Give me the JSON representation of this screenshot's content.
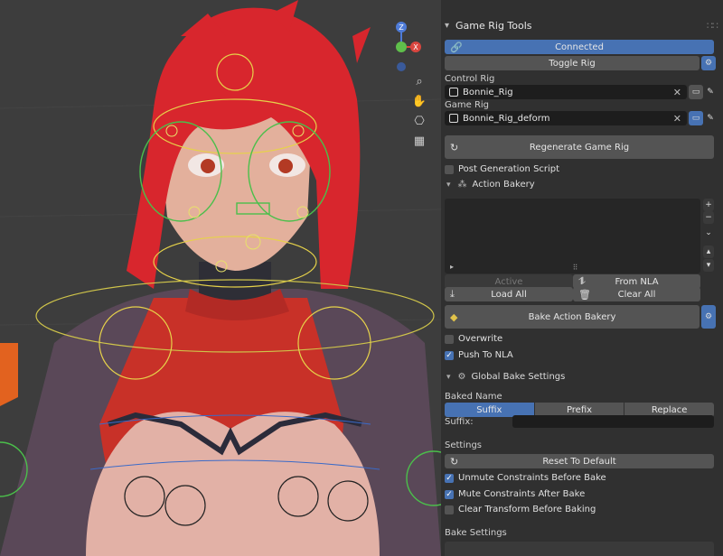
{
  "panel": {
    "title": "Game Rig Tools",
    "connected_label": "Connected",
    "toggle_rig_label": "Toggle Rig",
    "control_rig_label": "Control Rig",
    "control_rig_value": "Bonnie_Rig",
    "game_rig_label": "Game Rig",
    "game_rig_value": "Bonnie_Rig_deform",
    "regenerate_label": "Regenerate Game Rig",
    "post_generation_label": "Post Generation Script",
    "action_bakery_label": "Action Bakery",
    "active_label": "Active",
    "from_nla_label": "From NLA",
    "load_all_label": "Load All",
    "clear_all_label": "Clear All",
    "bake_action_bakery_label": "Bake Action Bakery",
    "overwrite_label": "Overwrite",
    "push_to_nla_label": "Push To NLA",
    "global_bake_label": "Global Bake Settings",
    "baked_name_label": "Baked Name",
    "name_modes": [
      "Suffix",
      "Prefix",
      "Replace"
    ],
    "selected_mode": "Suffix",
    "suffix_label": "Suffix:",
    "suffix_value": "",
    "settings_label": "Settings",
    "reset_default_label": "Reset To Default",
    "unmute_label": "Unmute Constraints Before Bake",
    "mute_label": "Mute Constraints After Bake",
    "clear_transform_label": "Clear Transform Before Baking",
    "bake_settings_label": "Bake Settings"
  },
  "checks": {
    "post_generation": false,
    "overwrite": false,
    "push_to_nla": true,
    "unmute": true,
    "mute": true,
    "clear_transform": false
  },
  "gizmo": {
    "z_label": "Z",
    "x_label": "X"
  },
  "colors": {
    "accent": "#4772b3",
    "panel_bg": "#303030",
    "viewport_bg": "#3d3d3d",
    "hair": "#d8262d"
  }
}
